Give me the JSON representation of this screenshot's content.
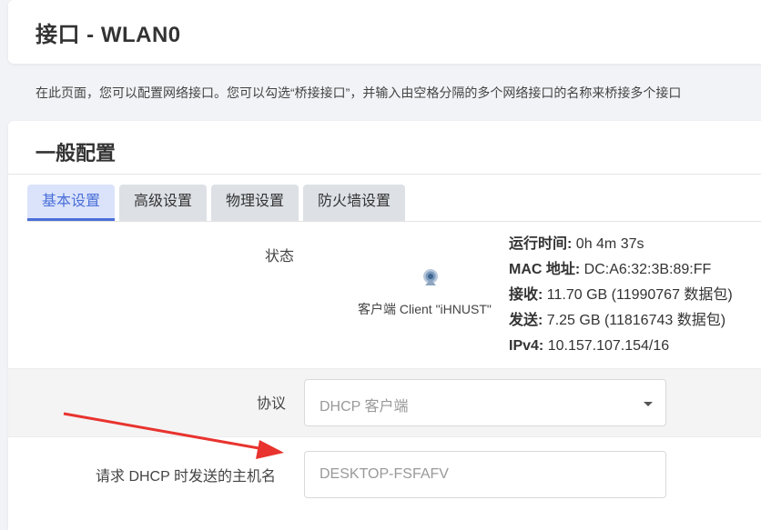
{
  "header": {
    "title": "接口 - WLAN0"
  },
  "description": "在此页面，您可以配置网络接口。您可以勾选“桥接接口”，并输入由空格分隔的多个网络接口的名称来桥接多个接口",
  "section": {
    "title": "一般配置"
  },
  "tabs": [
    {
      "label": "基本设置",
      "active": true
    },
    {
      "label": "高级设置",
      "active": false
    },
    {
      "label": "物理设置",
      "active": false
    },
    {
      "label": "防火墙设置",
      "active": false
    }
  ],
  "status": {
    "label": "状态",
    "client_icon": "wireless-client-icon",
    "client_label": "客户端 Client \"iHNUST\"",
    "uptime": {
      "key": "运行时间:",
      "value": " 0h 4m 37s"
    },
    "mac": {
      "key": "MAC 地址:",
      "value": " DC:A6:32:3B:89:FF"
    },
    "rx": {
      "key": "接收:",
      "value": " 11.70 GB (11990767 数据包)"
    },
    "tx": {
      "key": "发送:",
      "value": " 7.25 GB (11816743 数据包)"
    },
    "ipv4": {
      "key": "IPv4:",
      "value": " 10.157.107.154/16"
    }
  },
  "protocol": {
    "label": "协议",
    "selected": "DHCP 客户端"
  },
  "hostname": {
    "label": "请求 DHCP 时发送的主机名",
    "placeholder": "DESKTOP-FSFAFV",
    "value": ""
  },
  "colors": {
    "accent": "#4a6fd8",
    "annotation_arrow": "#e8332e"
  }
}
